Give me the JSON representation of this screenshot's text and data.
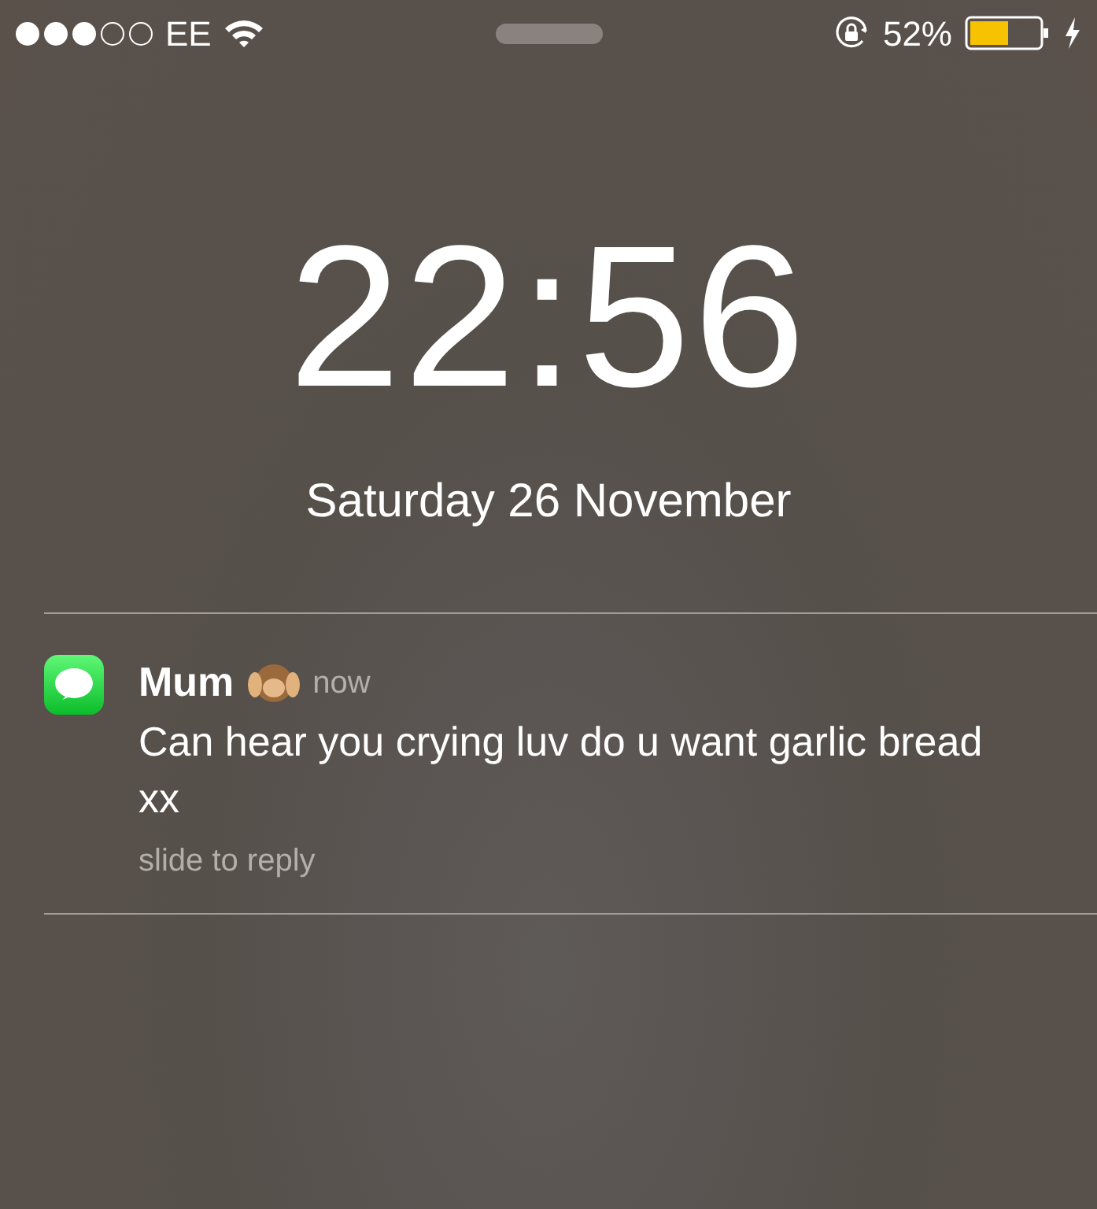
{
  "status_bar": {
    "carrier": "EE",
    "battery_percent": "52%",
    "charging": true,
    "rotation_lock": true
  },
  "lock_screen": {
    "time": "22:56",
    "date": "Saturday 26 November"
  },
  "notifications": [
    {
      "kind": "messages",
      "sender": "Mum",
      "time": "now",
      "message": "Can hear you crying luv do u want garlic bread xx",
      "action_hint": "slide to reply"
    }
  ]
}
